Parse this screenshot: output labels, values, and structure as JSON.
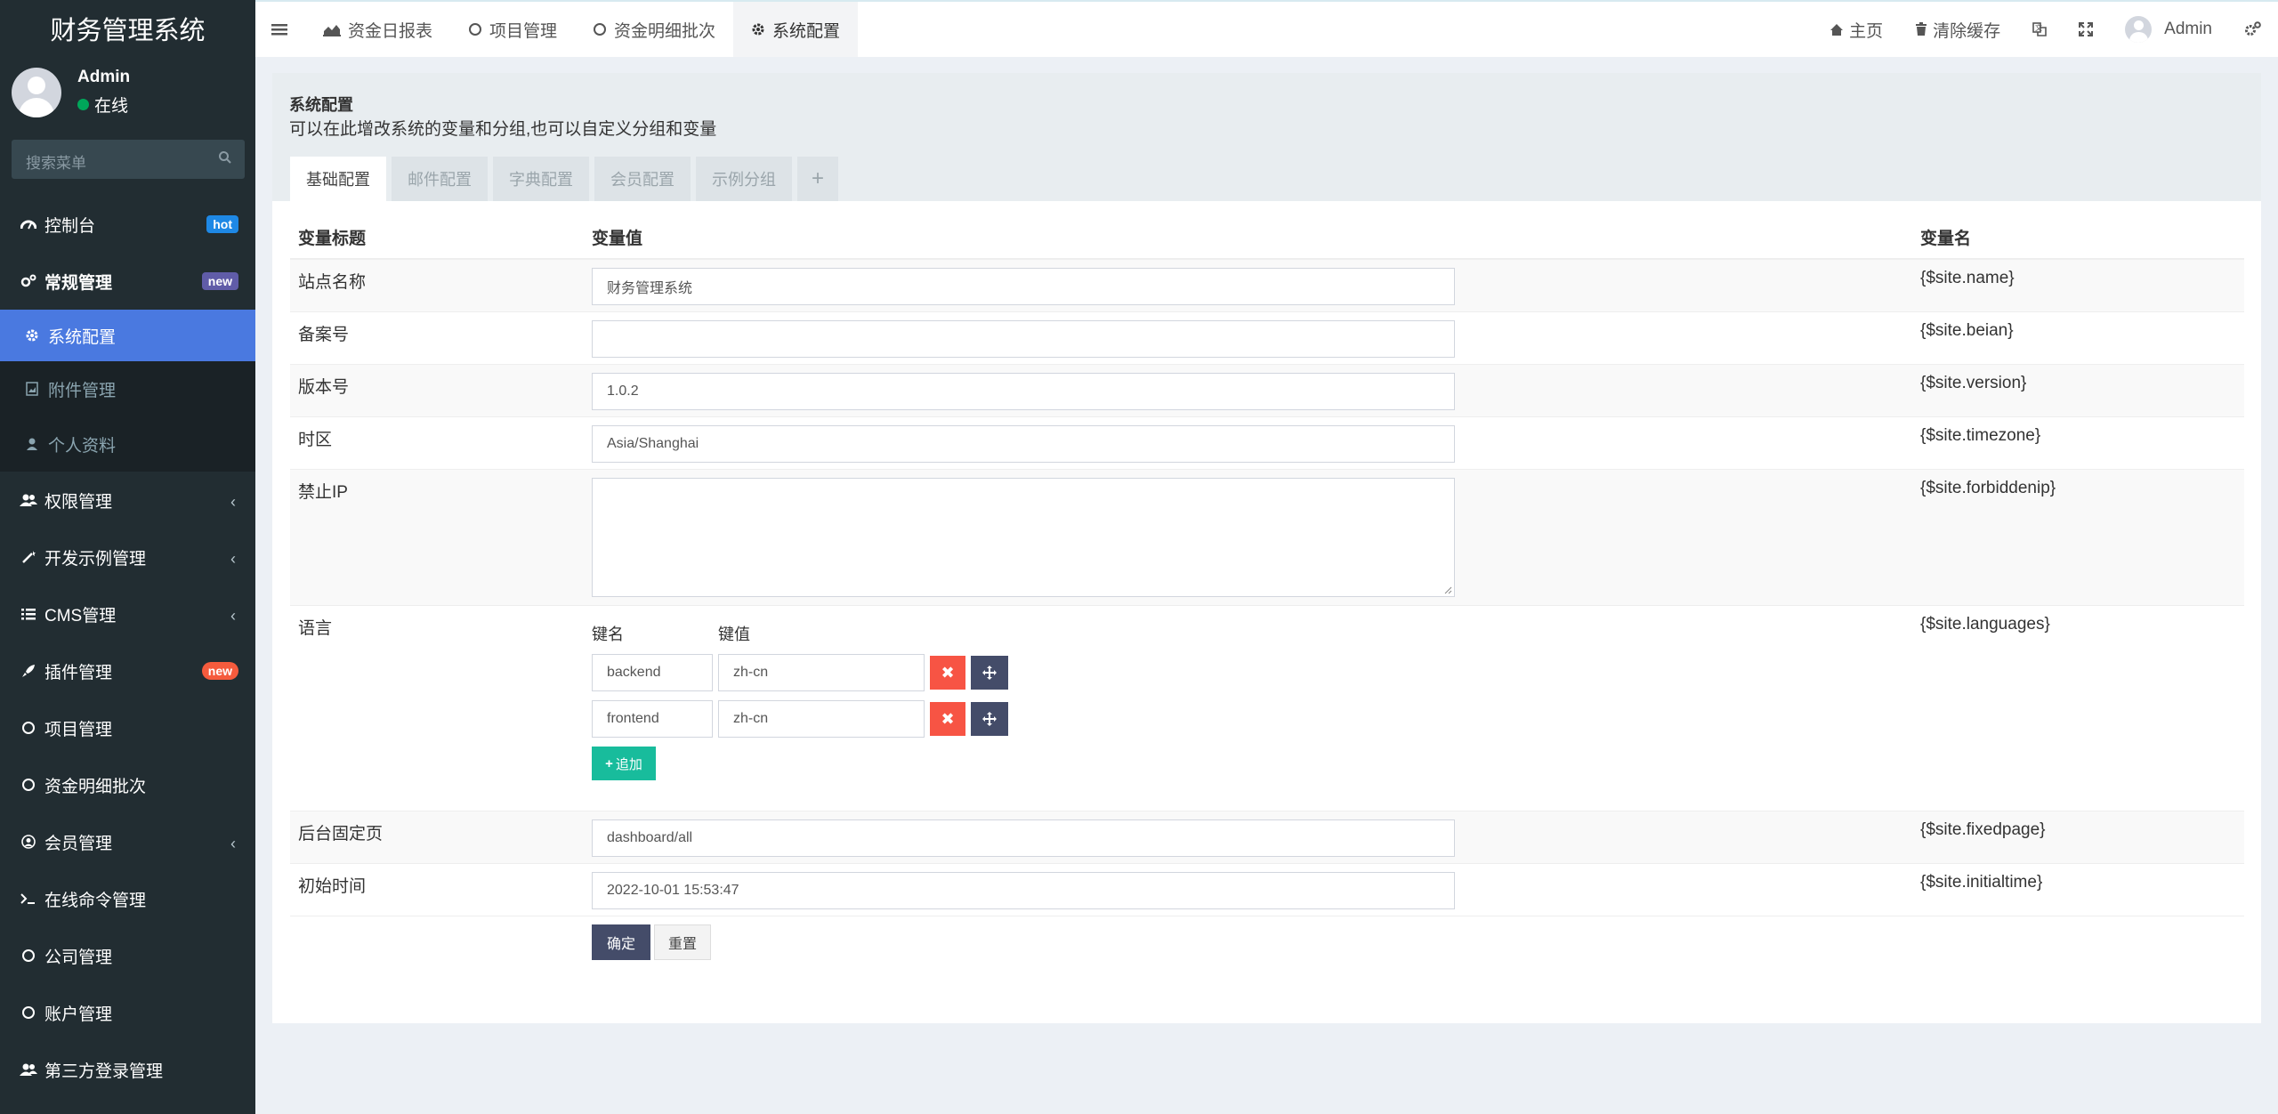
{
  "app": {
    "title": "财务管理系统"
  },
  "user": {
    "name": "Admin",
    "status": "在线"
  },
  "search": {
    "placeholder": "搜索菜单"
  },
  "sidebar": {
    "items": [
      {
        "label": "控制台",
        "icon": "dashboard-icon",
        "badge": "hot"
      },
      {
        "label": "常规管理",
        "icon": "cogs-icon",
        "badge": "new"
      },
      {
        "label": "系统配置",
        "icon": "gear-icon"
      },
      {
        "label": "附件管理",
        "icon": "file-image-icon"
      },
      {
        "label": "个人资料",
        "icon": "user-icon"
      },
      {
        "label": "权限管理",
        "icon": "users-icon"
      },
      {
        "label": "开发示例管理",
        "icon": "magic-icon"
      },
      {
        "label": "CMS管理",
        "icon": "list-icon"
      },
      {
        "label": "插件管理",
        "icon": "rocket-icon",
        "badge": "new"
      },
      {
        "label": "项目管理",
        "icon": "circle-icon"
      },
      {
        "label": "资金明细批次",
        "icon": "circle-icon"
      },
      {
        "label": "会员管理",
        "icon": "user-circle-icon"
      },
      {
        "label": "在线命令管理",
        "icon": "terminal-icon"
      },
      {
        "label": "公司管理",
        "icon": "circle-icon"
      },
      {
        "label": "账户管理",
        "icon": "circle-icon"
      },
      {
        "label": "第三方登录管理",
        "icon": "users-icon"
      }
    ]
  },
  "topnav": {
    "tabs": [
      {
        "label": "资金日报表",
        "icon": "area-chart-icon"
      },
      {
        "label": "项目管理",
        "icon": "circle-icon"
      },
      {
        "label": "资金明细批次",
        "icon": "circle-icon"
      },
      {
        "label": "系统配置",
        "icon": "gear-icon"
      }
    ],
    "right": {
      "home": "主页",
      "clear_cache": "清除缓存",
      "user": "Admin"
    }
  },
  "panel": {
    "title": "系统配置",
    "description": "可以在此增改系统的变量和分组,也可以自定义分组和变量",
    "tabs": [
      "基础配置",
      "邮件配置",
      "字典配置",
      "会员配置",
      "示例分组"
    ],
    "plus": "+"
  },
  "table": {
    "headers": {
      "title": "变量标题",
      "value": "变量值",
      "name": "变量名"
    },
    "rows": [
      {
        "title": "站点名称",
        "value": "财务管理系统",
        "name": "{$site.name}"
      },
      {
        "title": "备案号",
        "value": "",
        "name": "{$site.beian}"
      },
      {
        "title": "版本号",
        "value": "1.0.2",
        "name": "{$site.version}"
      },
      {
        "title": "时区",
        "value": "Asia/Shanghai",
        "name": "{$site.timezone}"
      },
      {
        "title": "禁止IP",
        "value": "",
        "name": "{$site.forbiddenip}"
      },
      {
        "title": "语言",
        "name": "{$site.languages}"
      },
      {
        "title": "后台固定页",
        "value": "dashboard/all",
        "name": "{$site.fixedpage}"
      },
      {
        "title": "初始时间",
        "value": "2022-10-01 15:53:47",
        "name": "{$site.initialtime}"
      }
    ],
    "languages": {
      "key_header": "键名",
      "value_header": "键值",
      "entries": [
        {
          "key": "backend",
          "value": "zh-cn"
        },
        {
          "key": "frontend",
          "value": "zh-cn"
        }
      ],
      "add_label": "追加"
    }
  },
  "actions": {
    "submit": "确定",
    "reset": "重置"
  },
  "colors": {
    "sidebar_bg": "#222d32",
    "active_item": "#4a79e0",
    "danger": "#f75444",
    "primary_dark": "#444c69",
    "success": "#18bc9c"
  }
}
